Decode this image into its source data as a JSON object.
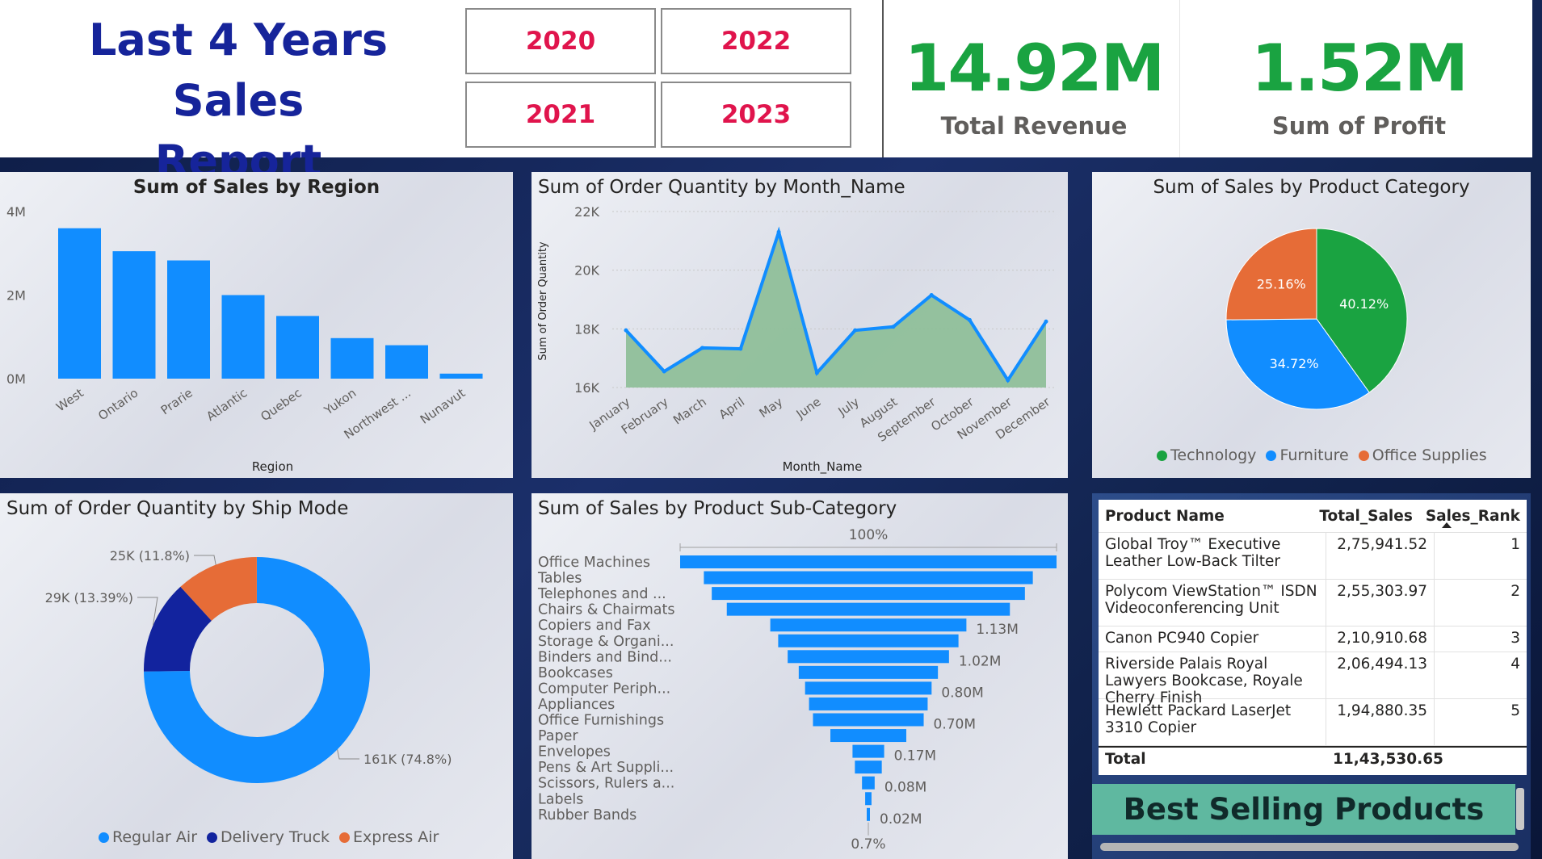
{
  "header": {
    "title_line1": "Last 4 Years Sales",
    "title_line2": "Report",
    "years": [
      "2020",
      "2022",
      "2021",
      "2023"
    ],
    "kpis": [
      {
        "value": "14.92M",
        "label": "Total Revenue"
      },
      {
        "value": "1.52M",
        "label": "Sum of Profit"
      }
    ]
  },
  "colors": {
    "bar_blue": "#118dff",
    "dark_blue": "#12239e",
    "orange": "#e66c37",
    "green": "#1aa341",
    "area_green": "#8fbf9a",
    "title_blue": "#16249a",
    "year_red": "#e0144c"
  },
  "chart_data": [
    {
      "type": "bar",
      "title": "Sum of Sales by Region",
      "xlabel": "Region",
      "ylabel": "",
      "categories": [
        "West",
        "Ontario",
        "Prarie",
        "Atlantic",
        "Quebec",
        "Yukon",
        "Northwest ...",
        "Nunavut"
      ],
      "values": [
        3.6,
        3.05,
        2.83,
        2.0,
        1.5,
        0.97,
        0.8,
        0.12
      ],
      "ylim": [
        0,
        4
      ],
      "yticks": [
        "0M",
        "2M",
        "4M"
      ],
      "grid": false
    },
    {
      "type": "area",
      "title": "Sum of Order Quantity by Month_Name",
      "xlabel": "Month_Name",
      "ylabel": "Sum of Order Quantity",
      "categories": [
        "January",
        "February",
        "March",
        "April",
        "May",
        "June",
        "July",
        "August",
        "September",
        "October",
        "November",
        "December"
      ],
      "values": [
        17950,
        16550,
        17350,
        17320,
        21300,
        16500,
        17950,
        18070,
        19150,
        18300,
        16250,
        18250
      ],
      "ylim": [
        16000,
        22000
      ],
      "yticks": [
        "16K",
        "18K",
        "20K",
        "22K"
      ],
      "grid": true
    },
    {
      "type": "pie",
      "title": "Sum of Sales by Product Category",
      "slices": [
        {
          "name": "Technology",
          "percent": 40.12,
          "label": "40.12%"
        },
        {
          "name": "Furniture",
          "percent": 34.72,
          "label": "34.72%"
        },
        {
          "name": "Office Supplies",
          "percent": 25.16,
          "label": "25.16%"
        }
      ],
      "legend": "bottom"
    },
    {
      "type": "pie",
      "title": "Sum of Order Quantity by Ship Mode",
      "donut": true,
      "slices": [
        {
          "name": "Regular Air",
          "percent": 74.8,
          "label": "161K (74.8%)"
        },
        {
          "name": "Delivery Truck",
          "percent": 13.39,
          "label": "29K (13.39%)"
        },
        {
          "name": "Express Air",
          "percent": 11.8,
          "label": "25K (11.8%)"
        }
      ],
      "legend": "bottom"
    },
    {
      "type": "bar",
      "subtype": "funnel",
      "title": "Sum of Sales by Product Sub-Category",
      "top_label": "100%",
      "bottom_label": "0.7%",
      "categories": [
        "Office Machines",
        "Tables",
        "Telephones and ...",
        "Chairs & Chairmats",
        "Copiers and Fax",
        "Storage & Organi...",
        "Binders and Bind...",
        "Bookcases",
        "Computer Periph...",
        "Appliances",
        "Office Furnishings",
        "Paper",
        "Envelopes",
        "Pens & Art Suppli...",
        "Scissors, Rulers a...",
        "Labels",
        "Rubber Bands"
      ],
      "values": [
        2.38,
        2.08,
        1.98,
        1.79,
        1.24,
        1.14,
        1.02,
        0.88,
        0.8,
        0.75,
        0.7,
        0.48,
        0.2,
        0.17,
        0.08,
        0.04,
        0.02
      ],
      "data_labels": [
        "",
        "",
        "",
        "",
        "1.13M",
        "",
        "1.02M",
        "",
        "0.80M",
        "",
        "0.70M",
        "",
        "0.17M",
        "",
        "0.08M",
        "",
        "0.02M"
      ]
    },
    {
      "type": "table",
      "title": "Best Selling Products",
      "columns": [
        "Product Name",
        "Total_Sales",
        "Sales_Rank"
      ],
      "rows": [
        [
          "Global Troy™ Executive Leather Low-Back Tilter",
          "2,75,941.52",
          "1"
        ],
        [
          "Polycom ViewStation™ ISDN Videoconferencing Unit",
          "2,55,303.97",
          "2"
        ],
        [
          "Canon PC940 Copier",
          "2,10,910.68",
          "3"
        ],
        [
          "Riverside Palais Royal Lawyers Bookcase, Royale Cherry Finish",
          "2,06,494.13",
          "4"
        ],
        [
          "Hewlett Packard LaserJet 3310 Copier",
          "1,94,880.35",
          "5"
        ]
      ],
      "total_label": "Total",
      "total_value": "11,43,530.65",
      "footer": "Best Selling Products"
    }
  ]
}
